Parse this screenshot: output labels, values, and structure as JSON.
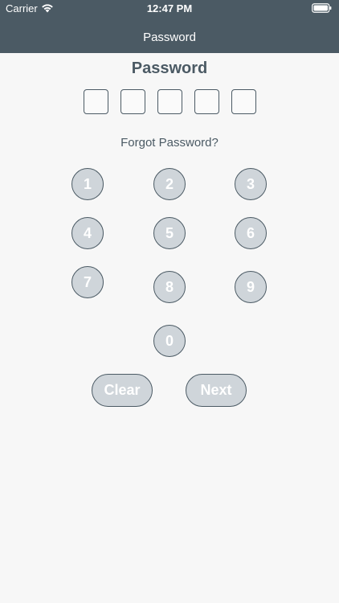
{
  "status_bar": {
    "carrier": "Carrier",
    "time": "12:47 PM"
  },
  "nav": {
    "title": "Password"
  },
  "screen": {
    "title": "Password",
    "pin_box_count": 5,
    "forgot_link": "Forgot Password?"
  },
  "keypad": {
    "keys": [
      "1",
      "2",
      "3",
      "4",
      "5",
      "6",
      "7",
      "8",
      "9",
      "0"
    ]
  },
  "actions": {
    "clear_label": "Clear",
    "next_label": "Next"
  },
  "colors": {
    "header_bg": "#4b5a64",
    "key_fill": "#cfd5da",
    "page_bg": "#f7f7f7"
  },
  "icons": {
    "wifi": "wifi-icon",
    "battery": "battery-icon"
  }
}
